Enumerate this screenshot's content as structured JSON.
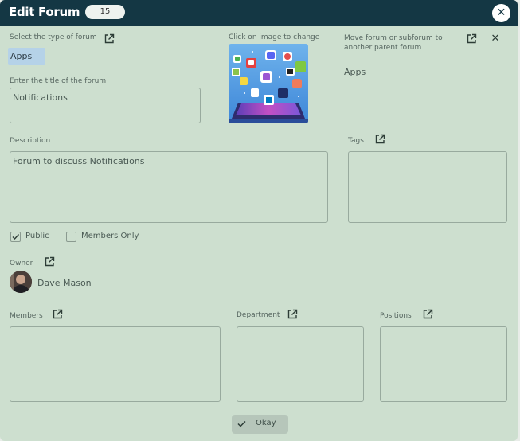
{
  "header": {
    "title": "Edit Forum",
    "count": "15"
  },
  "forum_type": {
    "label": "Select the type of forum",
    "value": "Apps"
  },
  "image": {
    "label": "Click on image to change"
  },
  "move": {
    "label_line1": "Move forum or subforum to",
    "label_line2": "another parent forum",
    "value": "Apps"
  },
  "title_field": {
    "label": "Enter the title of the forum",
    "value": "Notifications"
  },
  "description": {
    "label": "Description",
    "value": "Forum to discuss Notifications"
  },
  "tags": {
    "label": "Tags",
    "value": ""
  },
  "visibility": {
    "public_label": "Public",
    "public_checked": true,
    "members_only_label": "Members Only",
    "members_only_checked": false
  },
  "owner": {
    "label": "Owner",
    "name": "Dave Mason"
  },
  "members": {
    "label": "Members"
  },
  "department": {
    "label": "Department"
  },
  "positions": {
    "label": "Positions"
  },
  "footer": {
    "okay_label": "Okay"
  },
  "colors": {
    "titlebar": "#143744",
    "dialog_bg": "#cddfcf",
    "chip_bg": "#b5d2e8"
  }
}
